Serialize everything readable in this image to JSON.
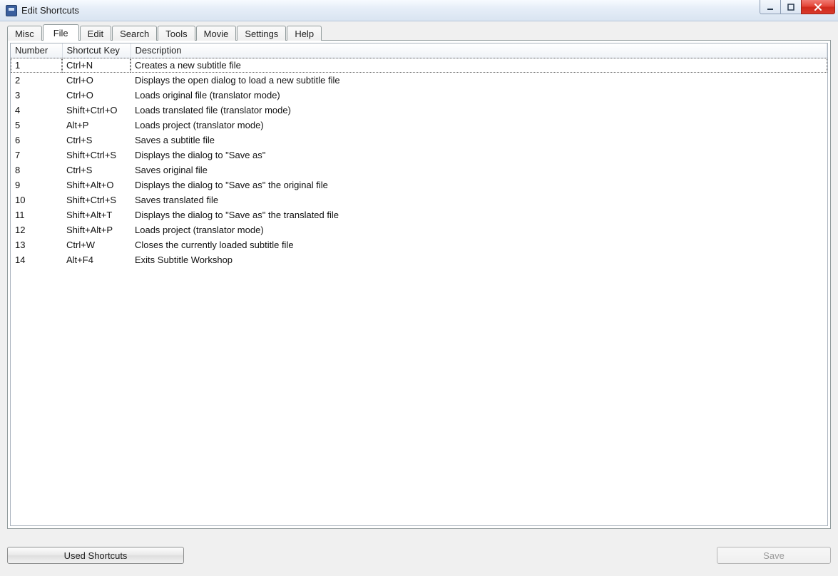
{
  "window": {
    "title": "Edit Shortcuts"
  },
  "tabs": [
    {
      "label": "Misc",
      "active": false
    },
    {
      "label": "File",
      "active": true
    },
    {
      "label": "Edit",
      "active": false
    },
    {
      "label": "Search",
      "active": false
    },
    {
      "label": "Tools",
      "active": false
    },
    {
      "label": "Movie",
      "active": false
    },
    {
      "label": "Settings",
      "active": false
    },
    {
      "label": "Help",
      "active": false
    }
  ],
  "table": {
    "columns": {
      "number": "Number",
      "key": "Shortcut Key",
      "description": "Description"
    },
    "rows": [
      {
        "number": "1",
        "key": "Ctrl+N",
        "description": "Creates a new subtitle file"
      },
      {
        "number": "2",
        "key": "Ctrl+O",
        "description": "Displays the open dialog to load a new subtitle file"
      },
      {
        "number": "3",
        "key": "Ctrl+O",
        "description": "Loads original file (translator mode)"
      },
      {
        "number": "4",
        "key": "Shift+Ctrl+O",
        "description": "Loads translated file (translator mode)"
      },
      {
        "number": "5",
        "key": "Alt+P",
        "description": "Loads project (translator mode)"
      },
      {
        "number": "6",
        "key": "Ctrl+S",
        "description": "Saves a subtitle file"
      },
      {
        "number": "7",
        "key": "Shift+Ctrl+S",
        "description": "Displays the dialog to \"Save as\""
      },
      {
        "number": "8",
        "key": "Ctrl+S",
        "description": "Saves original file"
      },
      {
        "number": "9",
        "key": "Shift+Alt+O",
        "description": "Displays the dialog to \"Save as\" the original file"
      },
      {
        "number": "10",
        "key": "Shift+Ctrl+S",
        "description": "Saves translated file"
      },
      {
        "number": "11",
        "key": "Shift+Alt+T",
        "description": "Displays the dialog to \"Save as\" the translated file"
      },
      {
        "number": "12",
        "key": "Shift+Alt+P",
        "description": "Loads project (translator mode)"
      },
      {
        "number": "13",
        "key": "Ctrl+W",
        "description": "Closes the currently loaded subtitle file"
      },
      {
        "number": "14",
        "key": "Alt+F4",
        "description": "Exits Subtitle Workshop"
      }
    ],
    "selected_index": 0
  },
  "buttons": {
    "used_shortcuts": "Used Shortcuts",
    "save": "Save"
  }
}
